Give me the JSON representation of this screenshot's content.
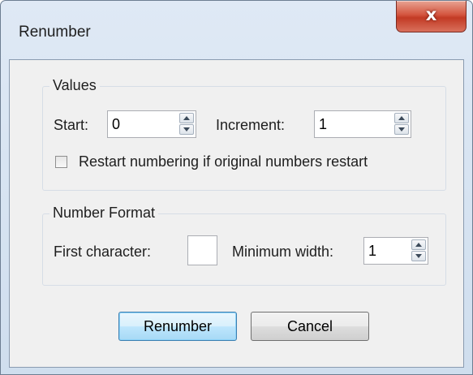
{
  "window": {
    "title": "Renumber",
    "close_glyph": "x"
  },
  "values_group": {
    "label": "Values",
    "start_label": "Start:",
    "start_value": "0",
    "increment_label": "Increment:",
    "increment_value": "1",
    "restart_checkbox_label": "Restart numbering if original numbers restart",
    "restart_checked": false
  },
  "format_group": {
    "label": "Number Format",
    "first_char_label": "First character:",
    "first_char_value": "",
    "min_width_label": "Minimum width:",
    "min_width_value": "1"
  },
  "buttons": {
    "ok_label": "Renumber",
    "cancel_label": "Cancel"
  }
}
